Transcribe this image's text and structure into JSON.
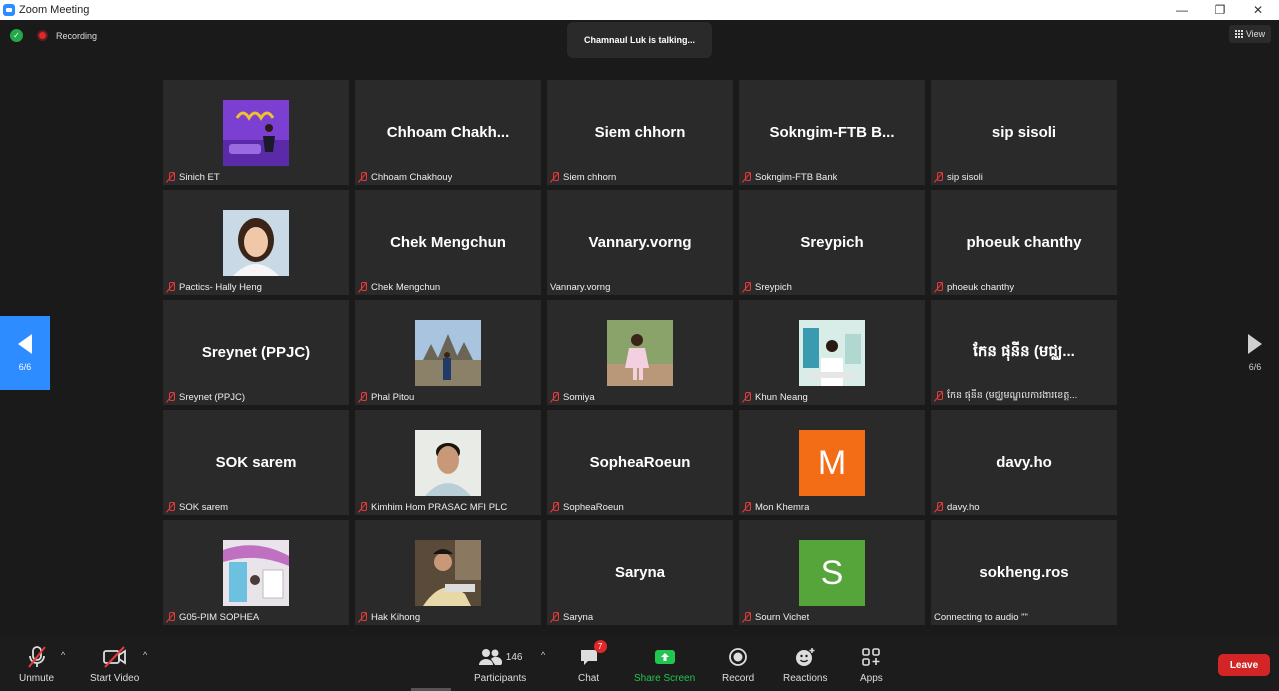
{
  "window": {
    "title": "Zoom Meeting",
    "controls": {
      "minimize": "—",
      "maximize": "❐",
      "close": "✕"
    }
  },
  "topbar": {
    "recording_label": "Recording",
    "talking_text": "Chamnaul Luk is talking...",
    "view_label": "View"
  },
  "pagination": {
    "left_page": "6/6",
    "right_page": "6/6"
  },
  "tiles": [
    {
      "display": "image",
      "image": "purple-room-photo",
      "label": "Sinich ET",
      "muted": true
    },
    {
      "display": "name",
      "center": "Chhoam  Chakh...",
      "label": "Chhoam Chakhouy",
      "muted": true
    },
    {
      "display": "name",
      "center": "Siem chhorn",
      "label": "Siem chhorn",
      "muted": true
    },
    {
      "display": "name",
      "center": "Sokngim-FTB  B...",
      "label": "Sokngim-FTB Bank",
      "muted": true
    },
    {
      "display": "name",
      "center": "sip sisoli",
      "label": "sip sisoli",
      "muted": true
    },
    {
      "display": "image",
      "image": "woman-portrait-photo",
      "label": "Pactics- Hally Heng",
      "muted": true
    },
    {
      "display": "name",
      "center": "Chek Mengchun",
      "label": "Chek Mengchun",
      "muted": true
    },
    {
      "display": "name",
      "center": "Vannary.vorng",
      "label": "Vannary.vorng",
      "muted": false
    },
    {
      "display": "name",
      "center": "Sreypich",
      "label": "Sreypich",
      "muted": true
    },
    {
      "display": "name",
      "center": "phoeuk chanthy",
      "label": "phoeuk chanthy",
      "muted": true
    },
    {
      "display": "name",
      "center": "Sreynet (PPJC)",
      "label": "Sreynet (PPJC)",
      "muted": true
    },
    {
      "display": "image",
      "image": "temple-photo",
      "label": "Phal Pitou",
      "muted": true
    },
    {
      "display": "image",
      "image": "child-photo",
      "label": "Somiya",
      "muted": true
    },
    {
      "display": "image",
      "image": "lab-photo",
      "label": "Khun Neang",
      "muted": true
    },
    {
      "display": "name",
      "center": "កែន ផុនីន (មជ្ឈ...",
      "label": "កែន ផុនីន (មជ្ឈមណ្ឌលការងារខេត្ត...",
      "muted": true
    },
    {
      "display": "name",
      "center": "SOK sarem",
      "label": "SOK sarem",
      "muted": true
    },
    {
      "display": "image",
      "image": "man-portrait-photo",
      "label": "Kimhim Hom PRASAC MFI PLC",
      "muted": true
    },
    {
      "display": "name",
      "center": "SopheaRoeun",
      "label": "SopheaRoeun",
      "muted": true
    },
    {
      "display": "letter",
      "letter": "M",
      "color": "#f26d16",
      "label": "Mon Khemra",
      "muted": true
    },
    {
      "display": "name",
      "center": "davy.ho",
      "label": "davy.ho",
      "muted": true
    },
    {
      "display": "image",
      "image": "room-photo",
      "label": "G05-PIM SOPHEA",
      "muted": true
    },
    {
      "display": "image",
      "image": "boy-photo",
      "label": "Hak Kihong",
      "muted": true
    },
    {
      "display": "name",
      "center": "Saryna",
      "label": "Saryna",
      "muted": true
    },
    {
      "display": "letter",
      "letter": "S",
      "color": "#56a53a",
      "label": "Sourn Vichet",
      "muted": true
    },
    {
      "display": "name",
      "center": "sokheng.ros",
      "label": "Connecting to audio \"\"",
      "muted": false
    }
  ],
  "toolbar": {
    "unmute_label": "Unmute",
    "start_video_label": "Start Video",
    "participants_label": "Participants",
    "participants_count": "146",
    "chat_label": "Chat",
    "chat_badge": "7",
    "share_screen_label": "Share Screen",
    "record_label": "Record",
    "reactions_label": "Reactions",
    "apps_label": "Apps",
    "leave_label": "Leave",
    "caret": "^"
  },
  "colors": {
    "accent": "#2d8cff",
    "leave": "#d32525",
    "share": "#23c552",
    "muted_icon": "#e83a3a"
  }
}
